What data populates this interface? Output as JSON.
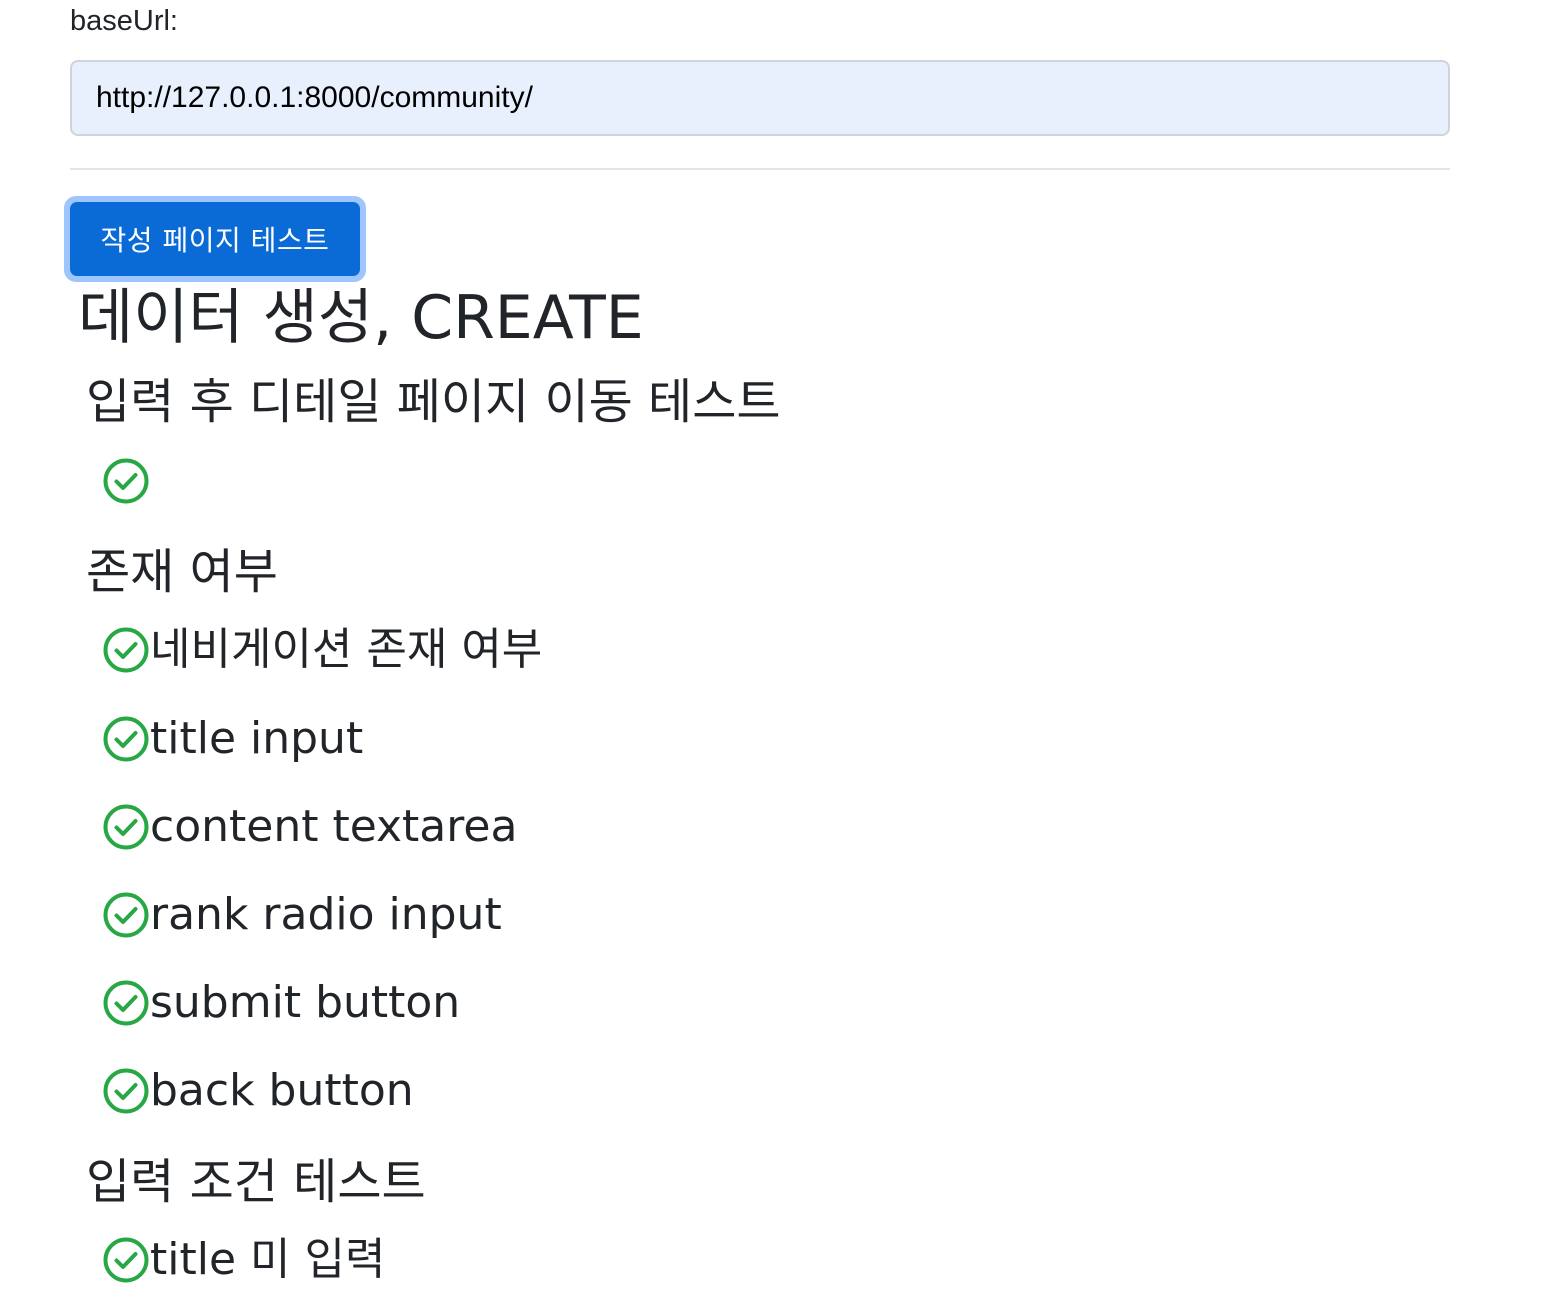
{
  "base": {
    "label": "baseUrl:",
    "url": "http://127.0.0.1:8000/community/"
  },
  "actions": {
    "test_button_label": "작성 페이지 테스트"
  },
  "create_section": {
    "title": "데이터 생성, CREATE",
    "groups": [
      {
        "title": "입력 후 디테일 페이지 이동 테스트",
        "items": [
          {
            "label": "",
            "status": "pass"
          }
        ]
      },
      {
        "title": "존재 여부",
        "items": [
          {
            "label": "네비게이션 존재 여부",
            "status": "pass"
          },
          {
            "label": "title input",
            "status": "pass"
          },
          {
            "label": "content textarea",
            "status": "pass"
          },
          {
            "label": "rank radio input",
            "status": "pass"
          },
          {
            "label": "submit button",
            "status": "pass"
          },
          {
            "label": "back button",
            "status": "pass"
          }
        ]
      },
      {
        "title": "입력 조건 테스트",
        "items": [
          {
            "label": "title 미 입력",
            "status": "pass"
          }
        ]
      }
    ]
  },
  "colors": {
    "pass": "#28a745",
    "button": "#0b6bd6",
    "button_focus_ring": "#9ec5fe",
    "input_bg": "#e8f0fe"
  }
}
